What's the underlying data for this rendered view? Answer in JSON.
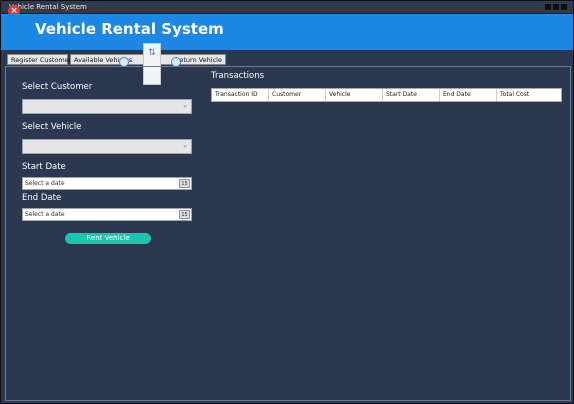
{
  "window": {
    "title": "Vehicle Rental System"
  },
  "header": {
    "title": "Vehicle Rental System"
  },
  "tabs": [
    {
      "label": "Register Customer"
    },
    {
      "label": "Available Vehicles"
    },
    {
      "label": "Return Vehicle"
    }
  ],
  "rental_form": {
    "customer_label": "Select Customer",
    "vehicle_label": "Select Vehicle",
    "start_label": "Start Date",
    "end_label": "End Date",
    "start_placeholder": "Select a date",
    "end_placeholder": "Select a date",
    "calendar_glyph": "15",
    "rent_button": "Rent Vehicle"
  },
  "transactions": {
    "title": "Transactions",
    "columns": [
      "Transaction ID",
      "Customer",
      "Vehicle",
      "Start Date",
      "End Date",
      "Total Cost"
    ]
  },
  "colors": {
    "header": "#1d87e4",
    "background": "#2b3850",
    "button": "#1cc3b0"
  },
  "icons": {
    "close": "close-icon",
    "calendar": "calendar-icon",
    "chevron": "chevron-down-icon"
  }
}
